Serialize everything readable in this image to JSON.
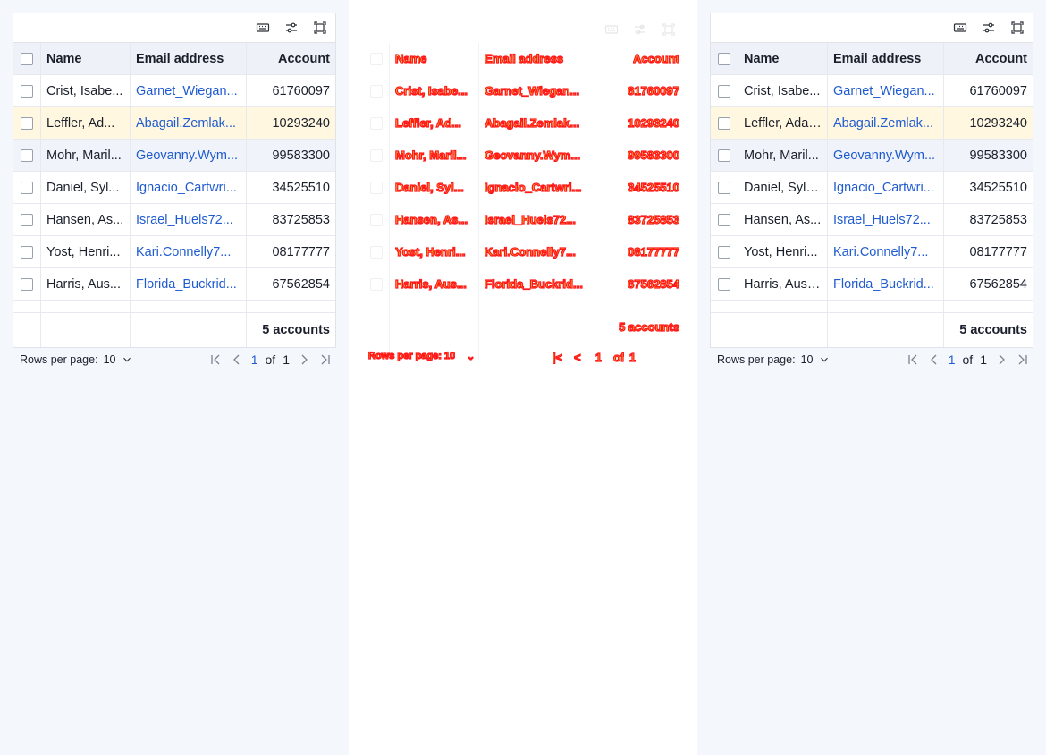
{
  "toolbar": {
    "icons": [
      "keyboard-icon",
      "sliders-icon",
      "fullscreen-icon"
    ]
  },
  "columns": {
    "name": "Name",
    "email": "Email address",
    "account": "Account"
  },
  "rows": [
    {
      "name": "Crist, Isabe...",
      "email": "Garnet_Wiegan...",
      "account": "61760097"
    },
    {
      "name": "Leffler, Ad...",
      "email": "Abagail.Zemlak...",
      "account": "10293240"
    },
    {
      "name": "Mohr, Maril...",
      "email": "Geovanny.Wym...",
      "account": "99583300"
    },
    {
      "name": "Daniel, Syl...",
      "email": "Ignacio_Cartwri...",
      "account": "34525510"
    },
    {
      "name": "Hansen, As...",
      "email": "Israel_Huels72...",
      "account": "83725853"
    },
    {
      "name": "Yost, Henri...",
      "email": "Kari.Connelly7...",
      "account": "08177777"
    },
    {
      "name": "Harris, Aus...",
      "email": "Florida_Buckrid...",
      "account": "67562854"
    }
  ],
  "rows_right": [
    {
      "name": "Crist, Isabe...",
      "email": "Garnet_Wiegan...",
      "account": "61760097"
    },
    {
      "name": "Leffler, Adal...",
      "email": "Abagail.Zemlak...",
      "account": "10293240"
    },
    {
      "name": "Mohr, Maril...",
      "email": "Geovanny.Wym...",
      "account": "99583300"
    },
    {
      "name": "Daniel, Sylv...",
      "email": "Ignacio_Cartwri...",
      "account": "34525510"
    },
    {
      "name": "Hansen, As...",
      "email": "Israel_Huels72...",
      "account": "83725853"
    },
    {
      "name": "Yost, Henri...",
      "email": "Kari.Connelly7...",
      "account": "08177777"
    },
    {
      "name": "Harris, Aust...",
      "email": "Florida_Buckrid...",
      "account": "67562854"
    }
  ],
  "footer": {
    "summary": "5 accounts"
  },
  "pagination": {
    "rows_per_page_label": "Rows per page:",
    "rows_per_page_value": "10",
    "current_page": "1",
    "of_label": "of",
    "total_pages": "1"
  },
  "middle": {
    "rows_per_page_text": "Rows per page: 10",
    "chevron": "⌄",
    "page_current": "1",
    "page_of": "of",
    "page_total": "1"
  },
  "colors": {
    "accent": "#1f5bd0",
    "row_highlight_warm": "#fff7df",
    "row_highlight_cool": "#f0f3f9",
    "heat_stroke": "#ff1a1a",
    "heat_fill": "#f2e84a"
  }
}
